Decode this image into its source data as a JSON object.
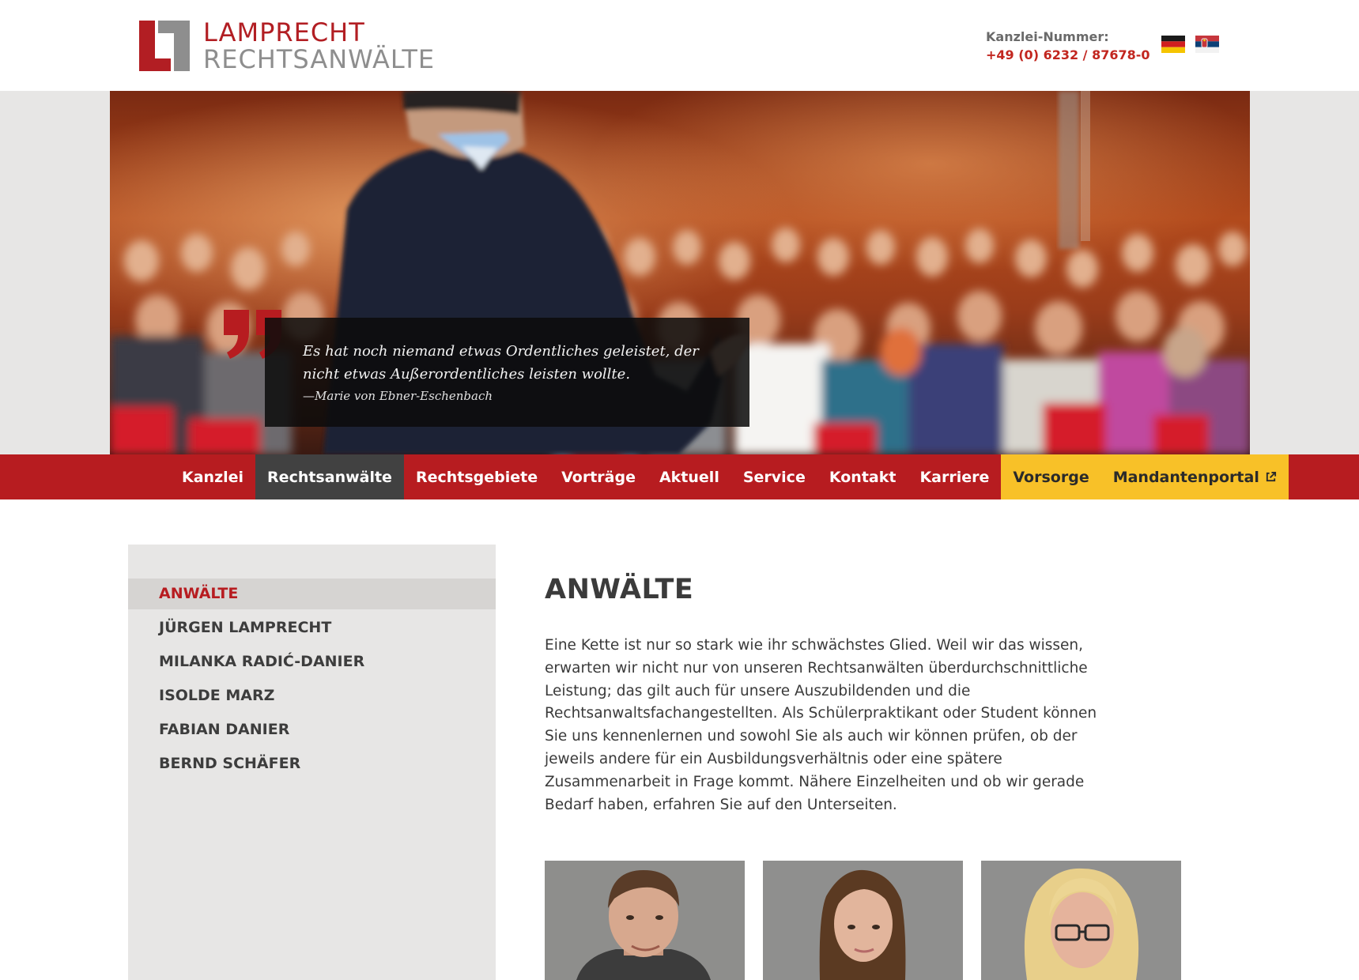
{
  "header": {
    "logo": {
      "line1": "LAMPRECHT",
      "line2": "RECHTSANWÄLTE",
      "brand_red": "#b21e23",
      "brand_gray": "#8e8e8e"
    },
    "phone_label": "Kanzlei-Nummer:",
    "phone_number": "+49 (0) 6232 / 87678-0",
    "languages": [
      {
        "name": "german-flag-icon"
      },
      {
        "name": "serbian-flag-icon"
      }
    ]
  },
  "hero": {
    "quote_text": "Es hat noch niemand etwas Ordentliches geleistet, der nicht etwas Außerordentliches leisten wollte.",
    "quote_author": "—Marie von Ebner-Eschenbach"
  },
  "nav": {
    "items": [
      {
        "label": "Kanzlei",
        "state": "normal"
      },
      {
        "label": "Rechtsanwälte",
        "state": "active"
      },
      {
        "label": "Rechtsgebiete",
        "state": "normal"
      },
      {
        "label": "Vorträge",
        "state": "normal"
      },
      {
        "label": "Aktuell",
        "state": "normal"
      },
      {
        "label": "Service",
        "state": "normal"
      },
      {
        "label": "Kontakt",
        "state": "normal"
      },
      {
        "label": "Karriere",
        "state": "normal"
      },
      {
        "label": "Vorsorge",
        "state": "highlight"
      },
      {
        "label": "Mandantenportal",
        "state": "highlight",
        "icon": "external-link-icon"
      }
    ],
    "colors": {
      "bar": "#b71c20",
      "active": "#414141",
      "highlight": "#f8c128"
    }
  },
  "sidebar": {
    "items": [
      {
        "label": "ANWÄLTE",
        "active": true
      },
      {
        "label": "JÜRGEN LAMPRECHT",
        "active": false
      },
      {
        "label": "MILANKA RADIĆ-DANIER",
        "active": false
      },
      {
        "label": "ISOLDE MARZ",
        "active": false
      },
      {
        "label": "FABIAN DANIER",
        "active": false
      },
      {
        "label": "BERND SCHÄFER",
        "active": false
      }
    ]
  },
  "main": {
    "title": "ANWÄLTE",
    "paragraph": "Eine Kette ist nur so stark wie ihr schwächstes Glied. Weil wir das wissen, erwarten wir nicht nur von unseren Rechtsanwälten überdurchschnittliche Leistung; das gilt auch für unsere Auszubildenden und die Rechtsanwaltsfachangestellten. Als Schülerpraktikant oder Student können Sie uns kennenlernen und sowohl Sie als auch wir können prüfen, ob der jeweils andere für ein Ausbildungsverhältnis oder eine spätere Zusammenarbeit in Frage kommt. Nähere Einzelheiten und ob wir gerade Bedarf haben, erfahren Sie auf den Unterseiten.",
    "portraits": [
      {
        "name": "portrait-man"
      },
      {
        "name": "portrait-woman-brown-hair"
      },
      {
        "name": "portrait-woman-blonde-glasses"
      }
    ]
  }
}
